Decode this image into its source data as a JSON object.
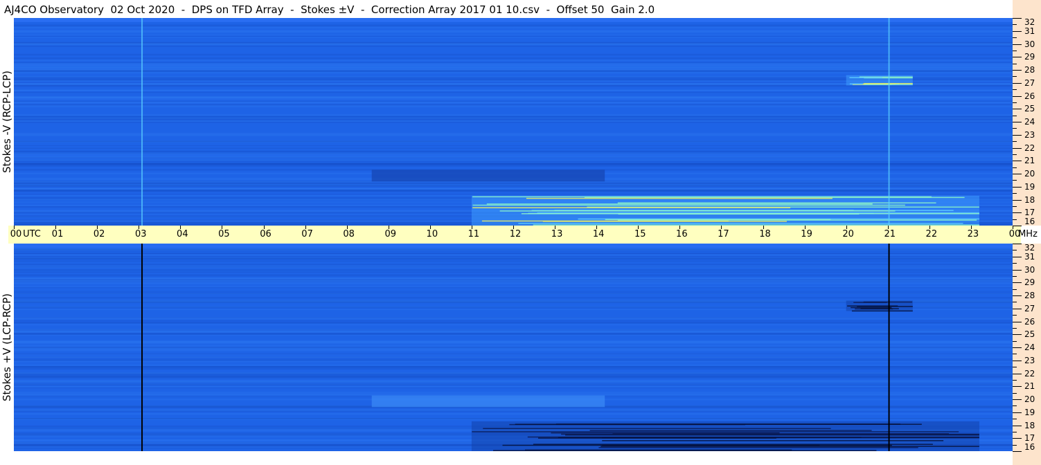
{
  "title": "AJ4CO Observatory  02 Oct 2020  -  DPS on TFD Array  -  Stokes ±V  -  Correction Array 2017 01 10.csv  -  Offset 50  Gain 2.0",
  "colors": {
    "background": "#1e63e6",
    "time_axis_bg": "#ffffc0",
    "freq_axis_bg": "#fde4cc",
    "burst_bright": "#8cf5c8",
    "burst_dark": "#0a1a55"
  },
  "chart_data": [
    {
      "type": "heatmap",
      "panel": "top",
      "ylabel": "Stokes -V (RCP-LCP)",
      "x_ticks": [
        "00",
        "01",
        "02",
        "03",
        "04",
        "05",
        "06",
        "07",
        "08",
        "09",
        "10",
        "11",
        "12",
        "13",
        "14",
        "15",
        "16",
        "17",
        "18",
        "19",
        "20",
        "21",
        "22",
        "23",
        "00"
      ],
      "x_unit_label": "UTC",
      "xlim": [
        0,
        24
      ],
      "y_ticks": [
        16,
        17,
        18,
        19,
        20,
        21,
        22,
        23,
        24,
        25,
        26,
        27,
        28,
        29,
        30,
        31,
        32
      ],
      "y_unit_label": "MHz",
      "ylim": [
        16,
        32
      ],
      "vertical_lines": [
        {
          "x": 3.08,
          "polarity": "bright"
        },
        {
          "x": 21.03,
          "polarity": "bright"
        }
      ],
      "features": [
        {
          "kind": "burst_band",
          "x_range": [
            11.0,
            23.2
          ],
          "y_range": [
            16.0,
            18.3
          ],
          "polarity": "bright"
        },
        {
          "kind": "burst_band",
          "x_range": [
            20.0,
            21.6
          ],
          "y_range": [
            26.8,
            27.6
          ],
          "polarity": "bright"
        },
        {
          "kind": "noise_region",
          "x_range": [
            8.6,
            14.2
          ],
          "y_range": [
            19.4,
            20.3
          ],
          "polarity": "dark"
        }
      ]
    },
    {
      "type": "heatmap",
      "panel": "bottom",
      "ylabel": "Stokes +V (LCP-RCP)",
      "x_ticks": [
        "00",
        "01",
        "02",
        "03",
        "04",
        "05",
        "06",
        "07",
        "08",
        "09",
        "10",
        "11",
        "12",
        "13",
        "14",
        "15",
        "16",
        "17",
        "18",
        "19",
        "20",
        "21",
        "22",
        "23",
        "00"
      ],
      "x_unit_label": "UTC",
      "xlim": [
        0,
        24
      ],
      "y_ticks": [
        16,
        17,
        18,
        19,
        20,
        21,
        22,
        23,
        24,
        25,
        26,
        27,
        28,
        29,
        30,
        31,
        32
      ],
      "y_unit_label": "MHz",
      "ylim": [
        16,
        32
      ],
      "vertical_lines": [
        {
          "x": 3.08,
          "polarity": "dark"
        },
        {
          "x": 21.03,
          "polarity": "dark"
        }
      ],
      "features": [
        {
          "kind": "burst_band",
          "x_range": [
            11.0,
            23.2
          ],
          "y_range": [
            16.0,
            18.3
          ],
          "polarity": "dark"
        },
        {
          "kind": "burst_band",
          "x_range": [
            20.0,
            21.6
          ],
          "y_range": [
            26.8,
            27.6
          ],
          "polarity": "dark"
        },
        {
          "kind": "noise_region",
          "x_range": [
            8.6,
            14.2
          ],
          "y_range": [
            19.4,
            20.3
          ],
          "polarity": "bright"
        }
      ]
    }
  ]
}
